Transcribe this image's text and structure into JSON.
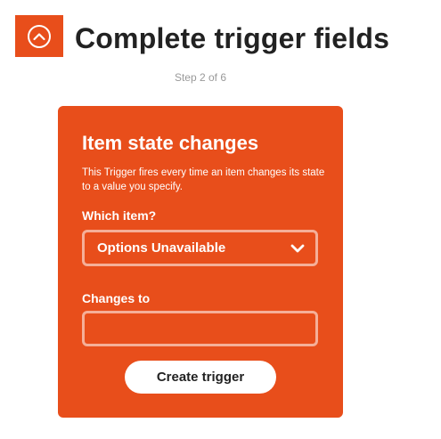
{
  "header": {
    "logo_icon": "up-chevron-circle-icon",
    "title": "Complete trigger fields",
    "step": "Step 2 of 6"
  },
  "card": {
    "title": "Item state changes",
    "description": "This Trigger fires every time an item changes its state to a value you specify.",
    "item_label": "Which item?",
    "item_value": "Options Unavailable",
    "item_select_icon": "chevron-down-icon",
    "changes_label": "Changes to",
    "changes_value": "",
    "submit_label": "Create trigger"
  },
  "colors": {
    "accent": "#e84e1b",
    "title_text": "#222222",
    "muted_text": "#999999"
  }
}
